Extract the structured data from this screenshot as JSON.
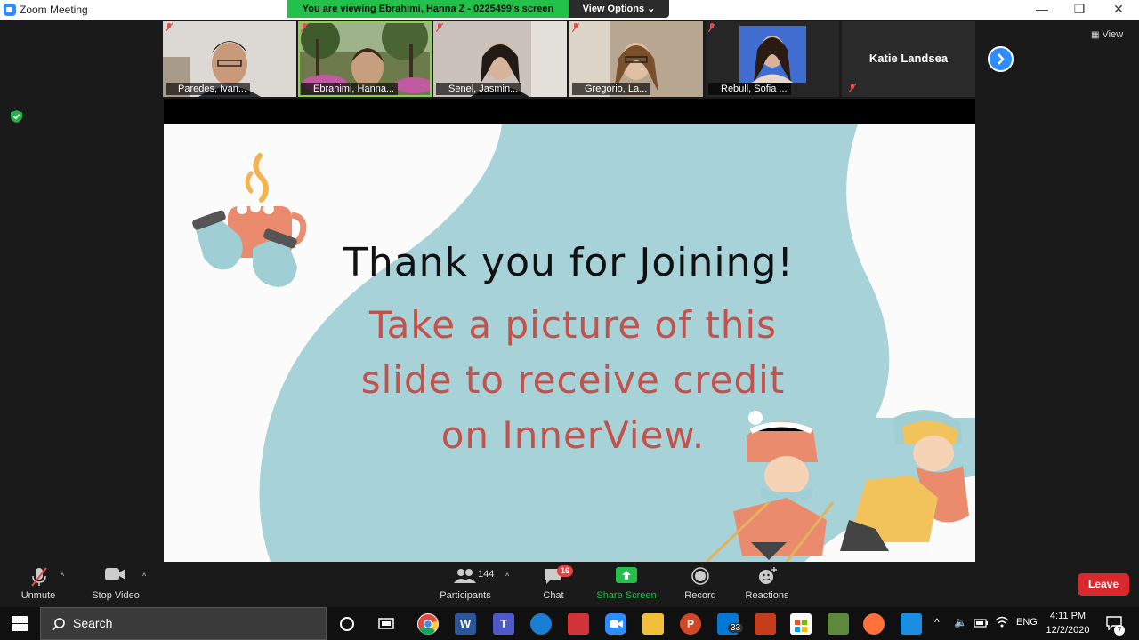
{
  "window": {
    "title": "Zoom Meeting",
    "controls": [
      "—",
      "❐",
      "✕"
    ]
  },
  "share_banner": {
    "viewing_text": "You are viewing Ebrahimi, Hanna Z - 0225499's screen",
    "view_options_label": "View Options ⌄"
  },
  "gallery": {
    "participants": [
      {
        "name": "Paredes, Ivan...",
        "active": false,
        "bg": "#d9d6d2"
      },
      {
        "name": "Ebrahimi, Hanna...",
        "active": true,
        "bg": "#6f7a4e"
      },
      {
        "name": "Senel, Jasmin...",
        "active": false,
        "bg": "#c8c0b8"
      },
      {
        "name": "Gregorio, La...",
        "active": false,
        "bg": "#b5a48e"
      },
      {
        "name": "Rebull, Sofia ...",
        "active": false,
        "bg": "#2a2a2a"
      },
      {
        "name": "Katie Landsea",
        "active": false,
        "bg": "#222222"
      }
    ],
    "view_label": "View"
  },
  "slide": {
    "heading": "Thank you for Joining!",
    "line1": "Take a picture of this",
    "line2": "slide to receive credit",
    "line3": "on InnerView."
  },
  "toolbar": {
    "unmute_label": "Unmute",
    "stop_video_label": "Stop Video",
    "participants_label": "Participants",
    "participants_count": "144",
    "chat_label": "Chat",
    "chat_badge": "16",
    "share_screen_label": "Share Screen",
    "record_label": "Record",
    "reactions_label": "Reactions",
    "leave_label": "Leave"
  },
  "taskbar": {
    "search_placeholder": "Search",
    "mail_badge": "33",
    "language": "ENG",
    "time": "4:11 PM",
    "date": "12/2/2020",
    "notification_count": "7"
  },
  "colors": {
    "accent_blue": "#2d8cff",
    "banner_green": "#23c04a",
    "leave_red": "#d9292d",
    "slide_teal": "#a6d2d8",
    "slide_red_text": "#c5524a"
  }
}
